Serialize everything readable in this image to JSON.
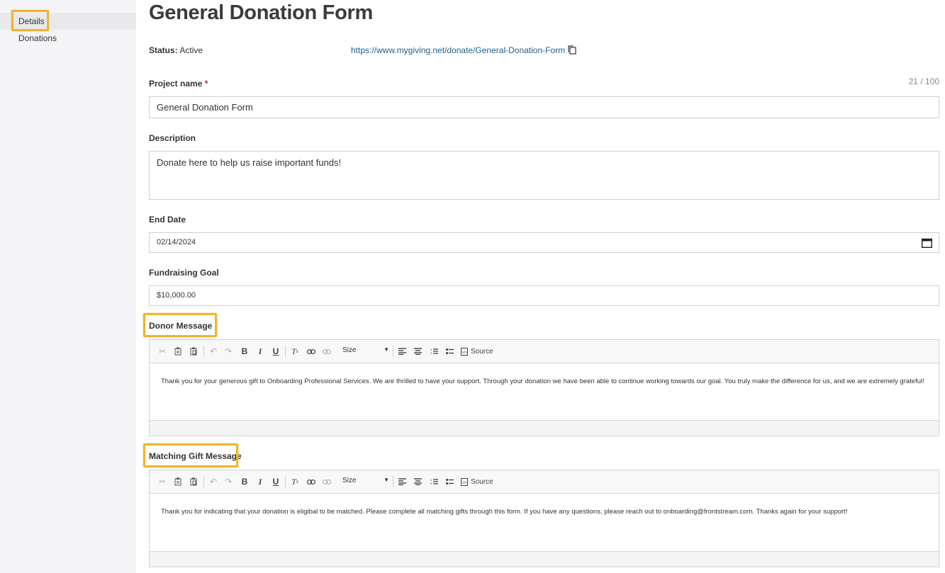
{
  "sidebar": {
    "items": [
      {
        "label": "Details"
      },
      {
        "label": "Donations"
      }
    ]
  },
  "page": {
    "title": "General Donation Form",
    "status_label": "Status:",
    "status_value": "Active",
    "url": "https://www.mygiving.net/donate/General-Donation-Form"
  },
  "form": {
    "project_name": {
      "label": "Project name",
      "required_mark": "*",
      "value": "General Donation Form",
      "counter": "21 / 100"
    },
    "description": {
      "label": "Description",
      "value": "Donate here to help us raise important funds!"
    },
    "end_date": {
      "label": "End Date",
      "value": "02/14/2024"
    },
    "fundraising_goal": {
      "label": "Fundraising Goal",
      "value": "$10,000.00"
    },
    "donor_message": {
      "label": "Donor Message",
      "body": "Thank you for your generous gift to Onboarding Professional Services. We are thrilled to have your support. Through your donation we have been able to continue working towards our goal. You truly make the difference for us, and we are extremely grateful!"
    },
    "matching_gift_message": {
      "label": "Matching Gift Message",
      "body": "Thank you for indicating that your donation is eligibal to be matched. Please complete all matching gifts through this form. If you have any questions, please reach out to onboarding@frontstream.com. Thanks again for your support!"
    }
  },
  "toolbar": {
    "size_label": "Size",
    "source_label": "Source",
    "bold": "B",
    "italic": "I",
    "underline": "U"
  },
  "icons": [
    "cut-icon",
    "copy-icon",
    "paste-icon",
    "undo-icon",
    "redo-icon",
    "remove-format-icon",
    "link-icon",
    "unlink-icon",
    "align-left-icon",
    "align-center-icon",
    "numbered-list-icon",
    "bulleted-list-icon",
    "source-icon",
    "calendar-icon",
    "copy-link-icon"
  ],
  "colors": {
    "highlight": "#f1b52c",
    "link": "#1f5f8b",
    "required": "#c0282d"
  }
}
